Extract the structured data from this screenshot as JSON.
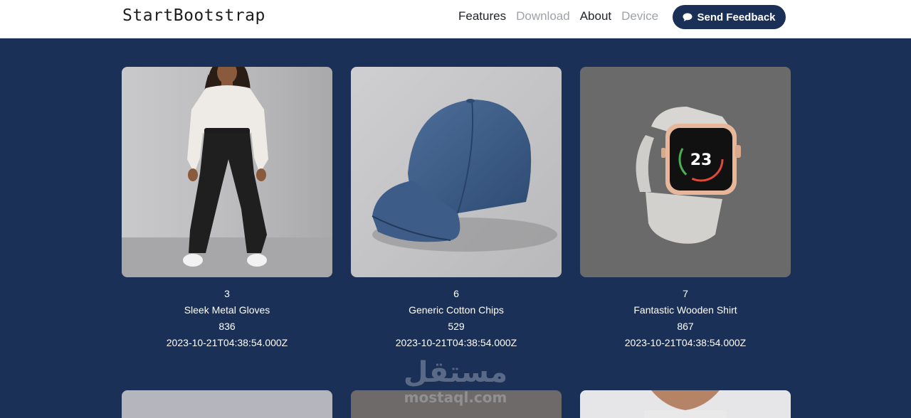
{
  "navbar": {
    "brand": "StartBootstrap",
    "links": [
      {
        "label": "Features",
        "muted": false
      },
      {
        "label": "Download",
        "muted": true
      },
      {
        "label": "About",
        "muted": false
      },
      {
        "label": "Device",
        "muted": true
      }
    ],
    "feedback_label": "Send Feedback",
    "feedback_icon": "chat-icon"
  },
  "products": [
    {
      "id": "3",
      "name": "Sleek Metal Gloves",
      "value": "836",
      "date": "2023-10-21T04:38:54.000Z",
      "image": "woman-in-sweatpants"
    },
    {
      "id": "6",
      "name": "Generic Cotton Chips",
      "value": "529",
      "date": "2023-10-21T04:38:54.000Z",
      "image": "blue-baseball-cap"
    },
    {
      "id": "7",
      "name": "Fantastic Wooden Shirt",
      "value": "867",
      "date": "2023-10-21T04:38:54.000Z",
      "image": "smartwatch"
    }
  ],
  "watermark": {
    "arabic": "مستقل",
    "latin": "mostaql.com"
  },
  "colors": {
    "page_background": "#1b3057",
    "button_background": "#1b3057",
    "navbar_background": "#ffffff"
  }
}
